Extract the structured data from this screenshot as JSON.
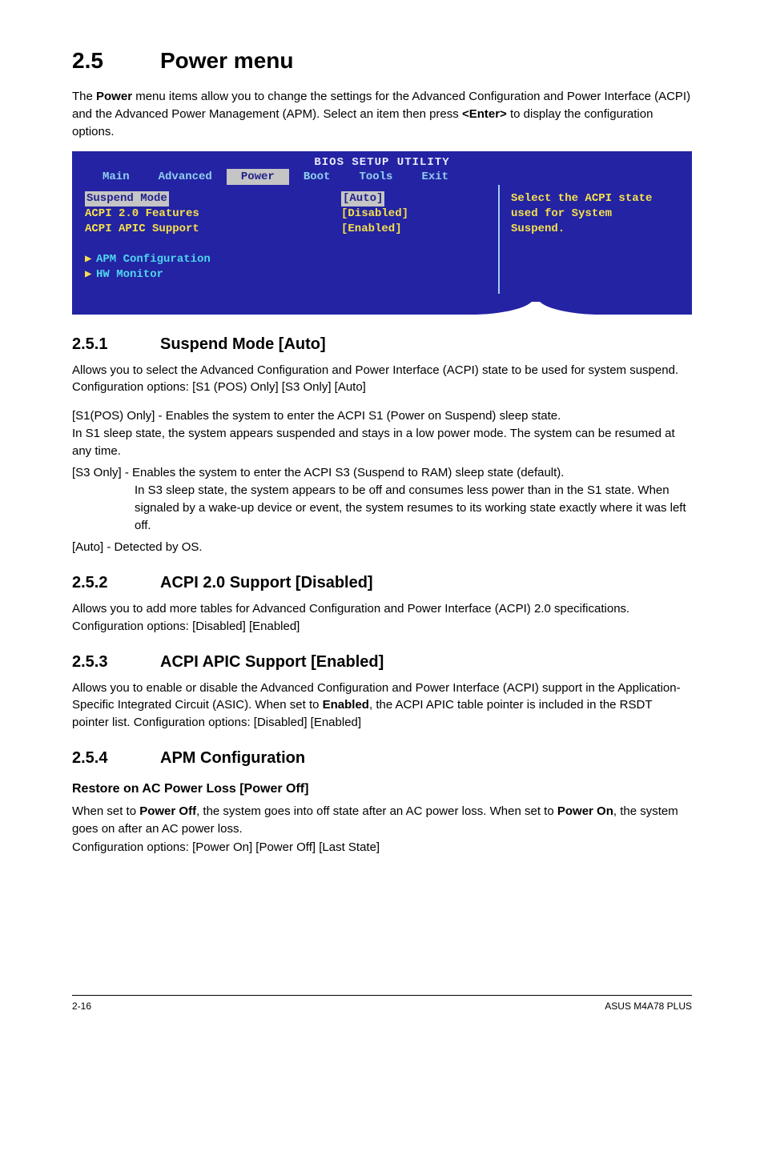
{
  "section": {
    "number": "2.5",
    "title": "Power menu",
    "intro_prefix": "The ",
    "intro_bold1": "Power",
    "intro_mid": " menu items allow you to change the settings for the Advanced Configuration and Power Interface (ACPI) and the Advanced Power Management (APM). Select an item then press ",
    "intro_bold2": "<Enter>",
    "intro_suffix": " to display the configuration options."
  },
  "bios": {
    "title": "BIOS SETUP UTILITY",
    "tabs": [
      "Main",
      "Advanced",
      "Power",
      "Boot",
      "Tools",
      "Exit"
    ],
    "active_tab_index": 2,
    "items": [
      {
        "label": "Suspend Mode",
        "value": "[Auto]",
        "selected": true
      },
      {
        "label": "ACPI 2.0 Features",
        "value": "[Disabled]",
        "selected": false
      },
      {
        "label": "ACPI APIC Support",
        "value": "[Enabled]",
        "selected": false
      }
    ],
    "sub_items": [
      "APM Configuration",
      "HW Monitor"
    ],
    "help": [
      "Select the ACPI state",
      "used for System",
      "Suspend."
    ]
  },
  "sub251": {
    "num": "2.5.1",
    "title": "Suspend Mode [Auto]",
    "p1": "Allows you to select the Advanced Configuration and Power Interface (ACPI) state to be used for system suspend. Configuration options: [S1 (POS) Only] [S3 Only] [Auto]",
    "s1_lead": "[S1(POS) Only] - Enables the system to enter the ACPI S1 (Power on Suspend) sleep state.",
    "s1_cont": "In S1 sleep state, the system appears suspended and stays in a low power mode. The system can be resumed at any time.",
    "s3_lead": "[S3 Only] - Enables the system to enter the ACPI S3 (Suspend to RAM) sleep state (default).",
    "s3_cont": "In S3 sleep state, the system appears to be off and consumes less power than in the S1 state. When signaled by a wake-up device or event, the system resumes to its working state exactly where it was left off.",
    "auto": "[Auto] - Detected by OS."
  },
  "sub252": {
    "num": "2.5.2",
    "title": "ACPI 2.0 Support [Disabled]",
    "p": "Allows you to add more tables for Advanced Configuration and Power Interface (ACPI) 2.0 specifications. Configuration options: [Disabled] [Enabled]"
  },
  "sub253": {
    "num": "2.5.3",
    "title": "ACPI APIC Support [Enabled]",
    "p_pre": "Allows you to enable or disable the Advanced Configuration and Power Interface (ACPI) support in the Application-Specific Integrated Circuit (ASIC). When set to ",
    "p_bold": "Enabled",
    "p_post": ", the ACPI APIC table pointer is included in the RSDT pointer list. Configuration options: [Disabled] [Enabled]"
  },
  "sub254": {
    "num": "2.5.4",
    "title": "APM Configuration",
    "h3": "Restore on AC Power Loss [Power Off]",
    "p_pre1": "When set to ",
    "p_b1": "Power Off",
    "p_mid": ", the system goes into off state after an AC power loss. When set to ",
    "p_b2": "Power On",
    "p_post": ", the system goes on after an AC power loss.",
    "p_cfg": "Configuration options: [Power On] [Power Off] [Last State]"
  },
  "footer": {
    "left": "2-16",
    "right": "ASUS M4A78 PLUS"
  }
}
